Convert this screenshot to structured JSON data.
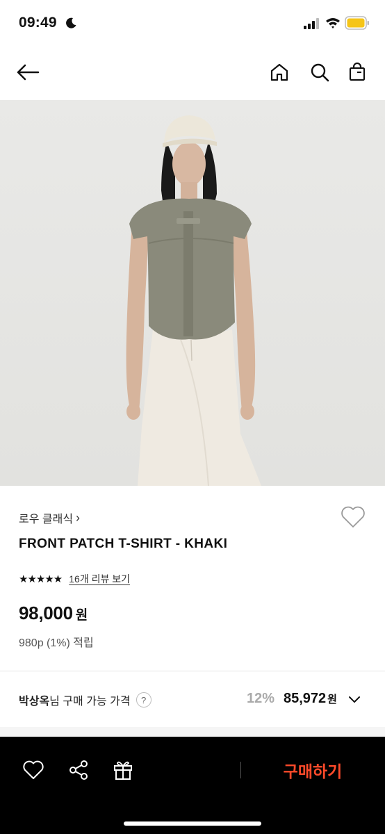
{
  "status_bar": {
    "time": "09:49",
    "icons": [
      "moon-icon",
      "signal-icon",
      "wifi-icon",
      "battery-icon"
    ],
    "battery_color": "#f5c518"
  },
  "nav": {
    "icons": [
      "back-arrow-icon",
      "home-icon",
      "search-icon",
      "shopping-bag-icon"
    ]
  },
  "product": {
    "brand": "로우 클래식",
    "brand_chevron": "›",
    "name": "FRONT PATCH T-SHIRT - KHAKI",
    "stars": "★★★★★",
    "review_link": "16개 리뷰 보기",
    "price": "98,000",
    "price_unit": "원",
    "points": "980p (1%) 적립"
  },
  "member_price": {
    "name": "박상옥",
    "label": "님 구매 가능 가격",
    "help": "?",
    "discount": "12%",
    "price": "85,972",
    "unit": "원"
  },
  "bottom_bar": {
    "buy_label": "구매하기",
    "buy_color": "#ff4a2a",
    "icons": [
      "heart-icon",
      "share-icon",
      "gift-icon"
    ]
  }
}
